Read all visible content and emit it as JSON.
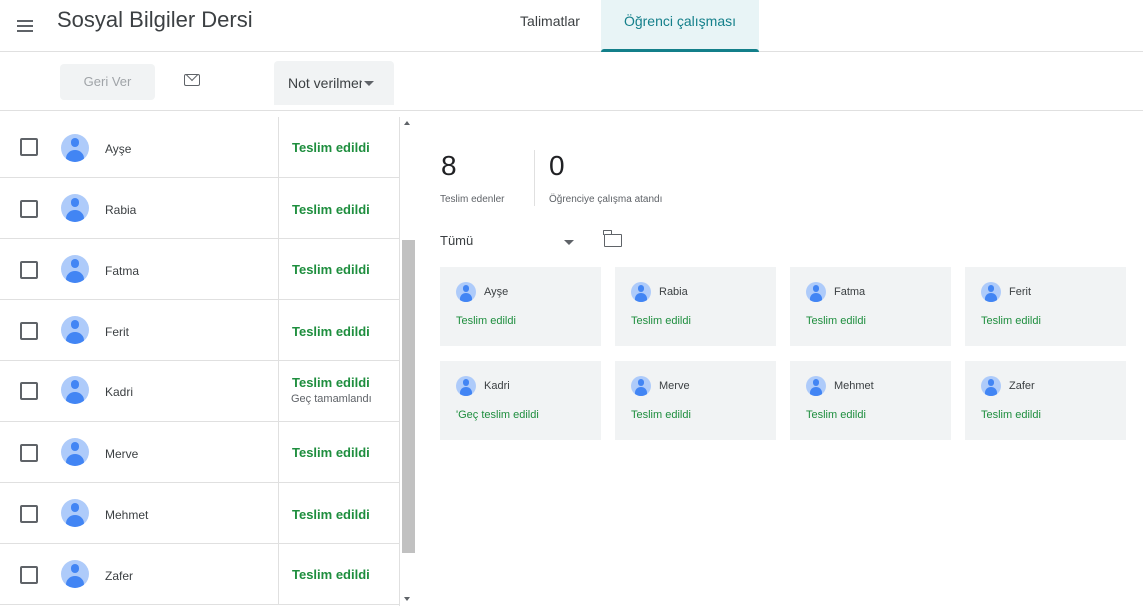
{
  "header": {
    "title": "Sosyal Bilgiler Dersi",
    "tabs": [
      {
        "label": "Talimatlar"
      },
      {
        "label": "Öğrenci çalışması"
      }
    ]
  },
  "toolbar": {
    "return_label": "Geri Ver",
    "grade_filter": "Not verilmemiş"
  },
  "students": [
    {
      "name": "Ayşe",
      "status": "Teslim edildi",
      "substatus": ""
    },
    {
      "name": "Rabia",
      "status": "Teslim edildi",
      "substatus": ""
    },
    {
      "name": "Fatma",
      "status": "Teslim edildi",
      "substatus": ""
    },
    {
      "name": "Ferit",
      "status": "Teslim edildi",
      "substatus": ""
    },
    {
      "name": "Kadri",
      "status": "Teslim edildi",
      "substatus": "Geç tamamlandı"
    },
    {
      "name": "Merve",
      "status": "Teslim edildi",
      "substatus": ""
    },
    {
      "name": "Mehmet",
      "status": "Teslim edildi",
      "substatus": ""
    },
    {
      "name": "Zafer",
      "status": "Teslim edildi",
      "substatus": ""
    }
  ],
  "stats": {
    "turned_in_count": "8",
    "turned_in_label": "Teslim edenler",
    "assigned_count": "0",
    "assigned_label": "Öğrenciye çalışma atandı"
  },
  "filter": {
    "value": "Tümü"
  },
  "cards": [
    {
      "name": "Ayşe",
      "status": "Teslim edildi"
    },
    {
      "name": "Rabia",
      "status": "Teslim edildi"
    },
    {
      "name": "Fatma",
      "status": "Teslim edildi"
    },
    {
      "name": "Ferit",
      "status": "Teslim edildi"
    },
    {
      "name": "Kadri",
      "status": "'Geç teslim edildi"
    },
    {
      "name": "Merve",
      "status": "Teslim edildi"
    },
    {
      "name": "Mehmet",
      "status": "Teslim edildi"
    },
    {
      "name": "Zafer",
      "status": "Teslim edildi"
    }
  ],
  "colors": {
    "accent": "#137f8a",
    "status_green": "#1e8e3e",
    "avatar": "#4285f4"
  }
}
